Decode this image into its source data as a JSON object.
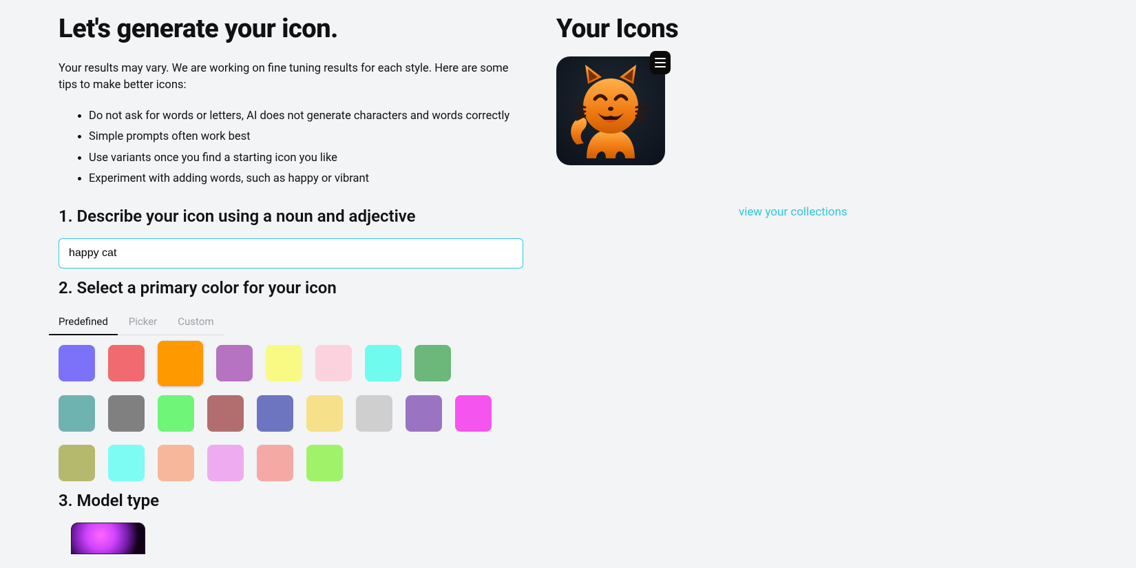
{
  "left": {
    "title": "Let's generate your icon.",
    "intro": "Your results may vary. We are working on fine tuning results for each style. Here are some tips to make better icons:",
    "tips": [
      "Do not ask for words or letters, AI does not generate characters and words correctly",
      "Simple prompts often work best",
      "Use variants once you find a starting icon you like",
      "Experiment with adding words, such as happy or vibrant"
    ],
    "step1_title": "1. Describe your icon using a noun and adjective",
    "prompt_value": "happy cat",
    "step2_title": "2. Select a primary color for your icon",
    "tabs": {
      "predefined": "Predefined",
      "picker": "Picker",
      "custom": "Custom"
    },
    "colors": [
      "#7c72f9",
      "#f06a6f",
      "#ff9900",
      "#b573c1",
      "#f8fa84",
      "#fcd2de",
      "#6ffbee",
      "#6cb77a",
      "#6fb3b1",
      "#808080",
      "#6ff577",
      "#b26e6e",
      "#6d75c0",
      "#f7e08a",
      "#cfcfcf",
      "#9a74c3",
      "#f554ee",
      "#b4b96d",
      "#7dfcf4",
      "#f7b79a",
      "#efabef",
      "#f4a9a4",
      "#a0f269"
    ],
    "selected_color_index": 2,
    "step3_title": "3. Model type"
  },
  "right": {
    "title": "Your Icons",
    "view_collections": "view your collections"
  }
}
